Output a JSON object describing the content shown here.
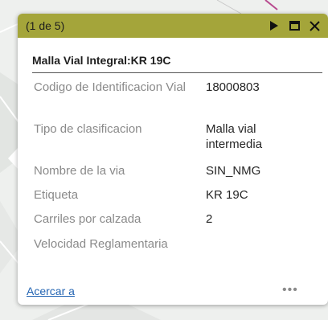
{
  "popup": {
    "counter": "(1 de 5)",
    "title": "Malla Vial Integral:KR 19C",
    "fields": [
      {
        "label": "Codigo de Identificacion Vial",
        "value": "18000803"
      },
      {
        "label": "Tipo de clasificacion",
        "value": "Malla vial intermedia"
      },
      {
        "label": "Nombre de la via",
        "value": "SIN_NMG"
      },
      {
        "label": "Etiqueta",
        "value": "KR 19C"
      },
      {
        "label": "Carriles por calzada",
        "value": "2"
      },
      {
        "label": "Velocidad Reglamentaria",
        "value": ""
      }
    ],
    "zoom_link": "Acercar a",
    "more_label": "•••"
  },
  "colors": {
    "titlebar": "#a4a53a",
    "link": "#2465b3"
  },
  "icons": {
    "next": "play-triangle-icon",
    "maximize": "maximize-icon",
    "close": "close-icon"
  }
}
